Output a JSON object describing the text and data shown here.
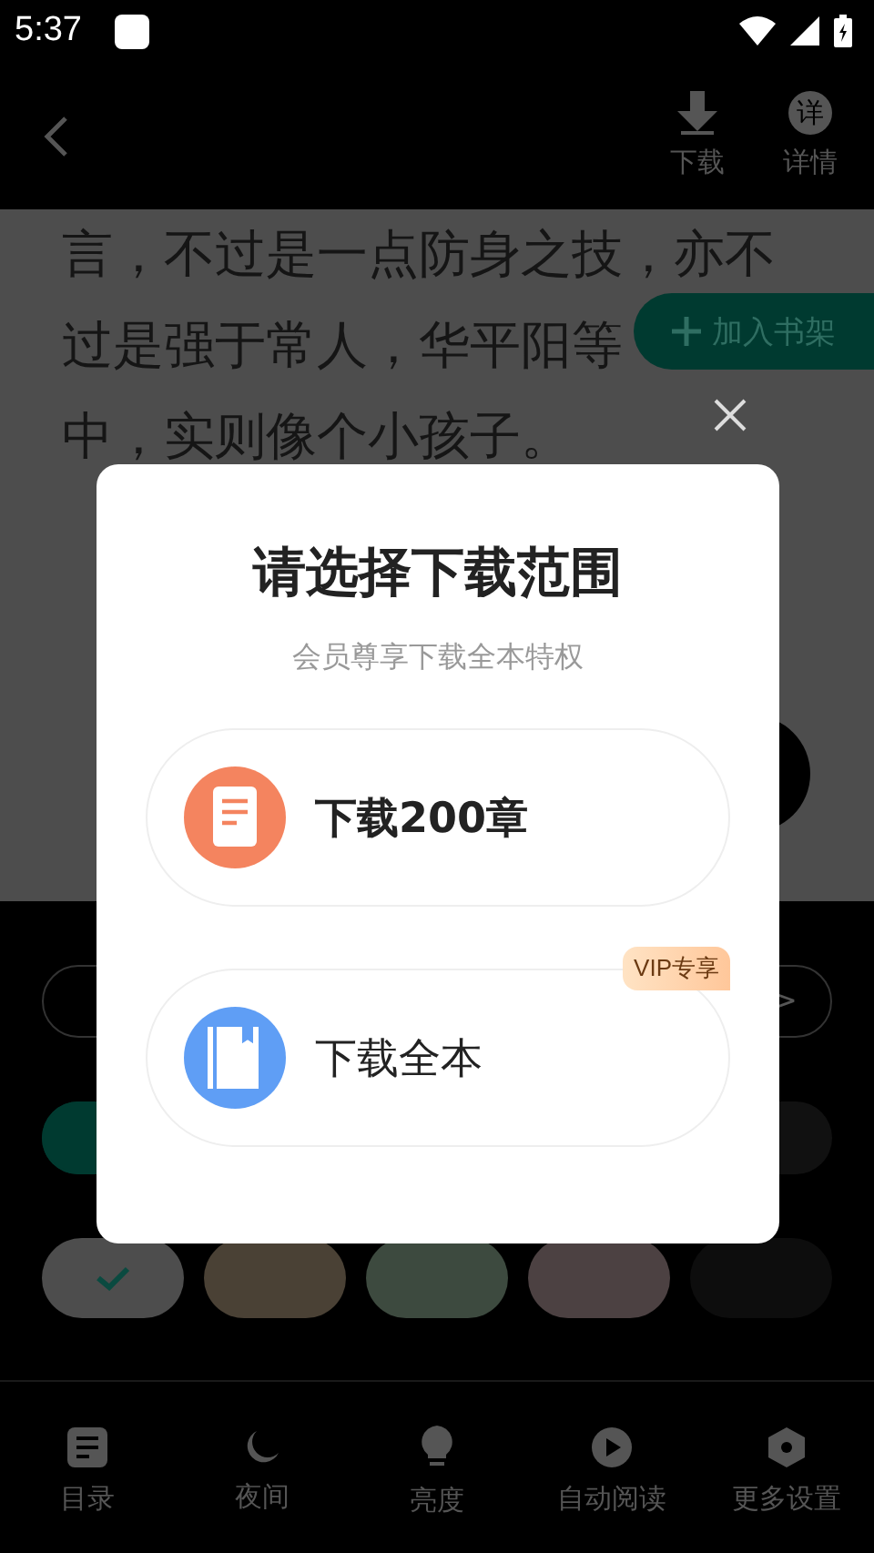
{
  "status_bar": {
    "time": "5:37"
  },
  "top_bar": {
    "actions": [
      {
        "kind": "download",
        "label": "下载"
      },
      {
        "kind": "details",
        "icon_text": "详",
        "label": "详情"
      }
    ]
  },
  "reading": {
    "lines": [
      "言，不过是一点防身之技，亦不",
      "过是强于常人，华平阳等",
      "中，实则像个小孩子。"
    ],
    "shelf_button": "加入书架"
  },
  "settings": {
    "font_row": [
      {
        "kind": "decrease"
      },
      {
        "kind": "increase",
        "label": ">"
      }
    ],
    "mode_row": [
      {
        "selected": true,
        "color": "#003a30"
      },
      {
        "selected": false,
        "color": "#111111"
      }
    ],
    "themes": [
      {
        "color": "#4d4d4d",
        "selected": true
      },
      {
        "color": "#4a4135",
        "selected": false
      },
      {
        "color": "#3d4a3f",
        "selected": false
      },
      {
        "color": "#4c4142",
        "selected": false
      },
      {
        "color": "#0d0d0d",
        "selected": false
      }
    ]
  },
  "nav": [
    {
      "kind": "toc",
      "label": "目录"
    },
    {
      "kind": "night",
      "label": "夜间"
    },
    {
      "kind": "brightness",
      "label": "亮度"
    },
    {
      "kind": "autoread",
      "label": "自动阅读"
    },
    {
      "kind": "more",
      "label": "更多设置"
    }
  ],
  "dialog": {
    "title": "请选择下载范围",
    "subtitle": "会员尊享下载全本特权",
    "options": [
      {
        "kind": "chapters",
        "label": "下载200章"
      },
      {
        "kind": "full",
        "label": "下载全本",
        "badge": "VIP专享"
      }
    ]
  }
}
